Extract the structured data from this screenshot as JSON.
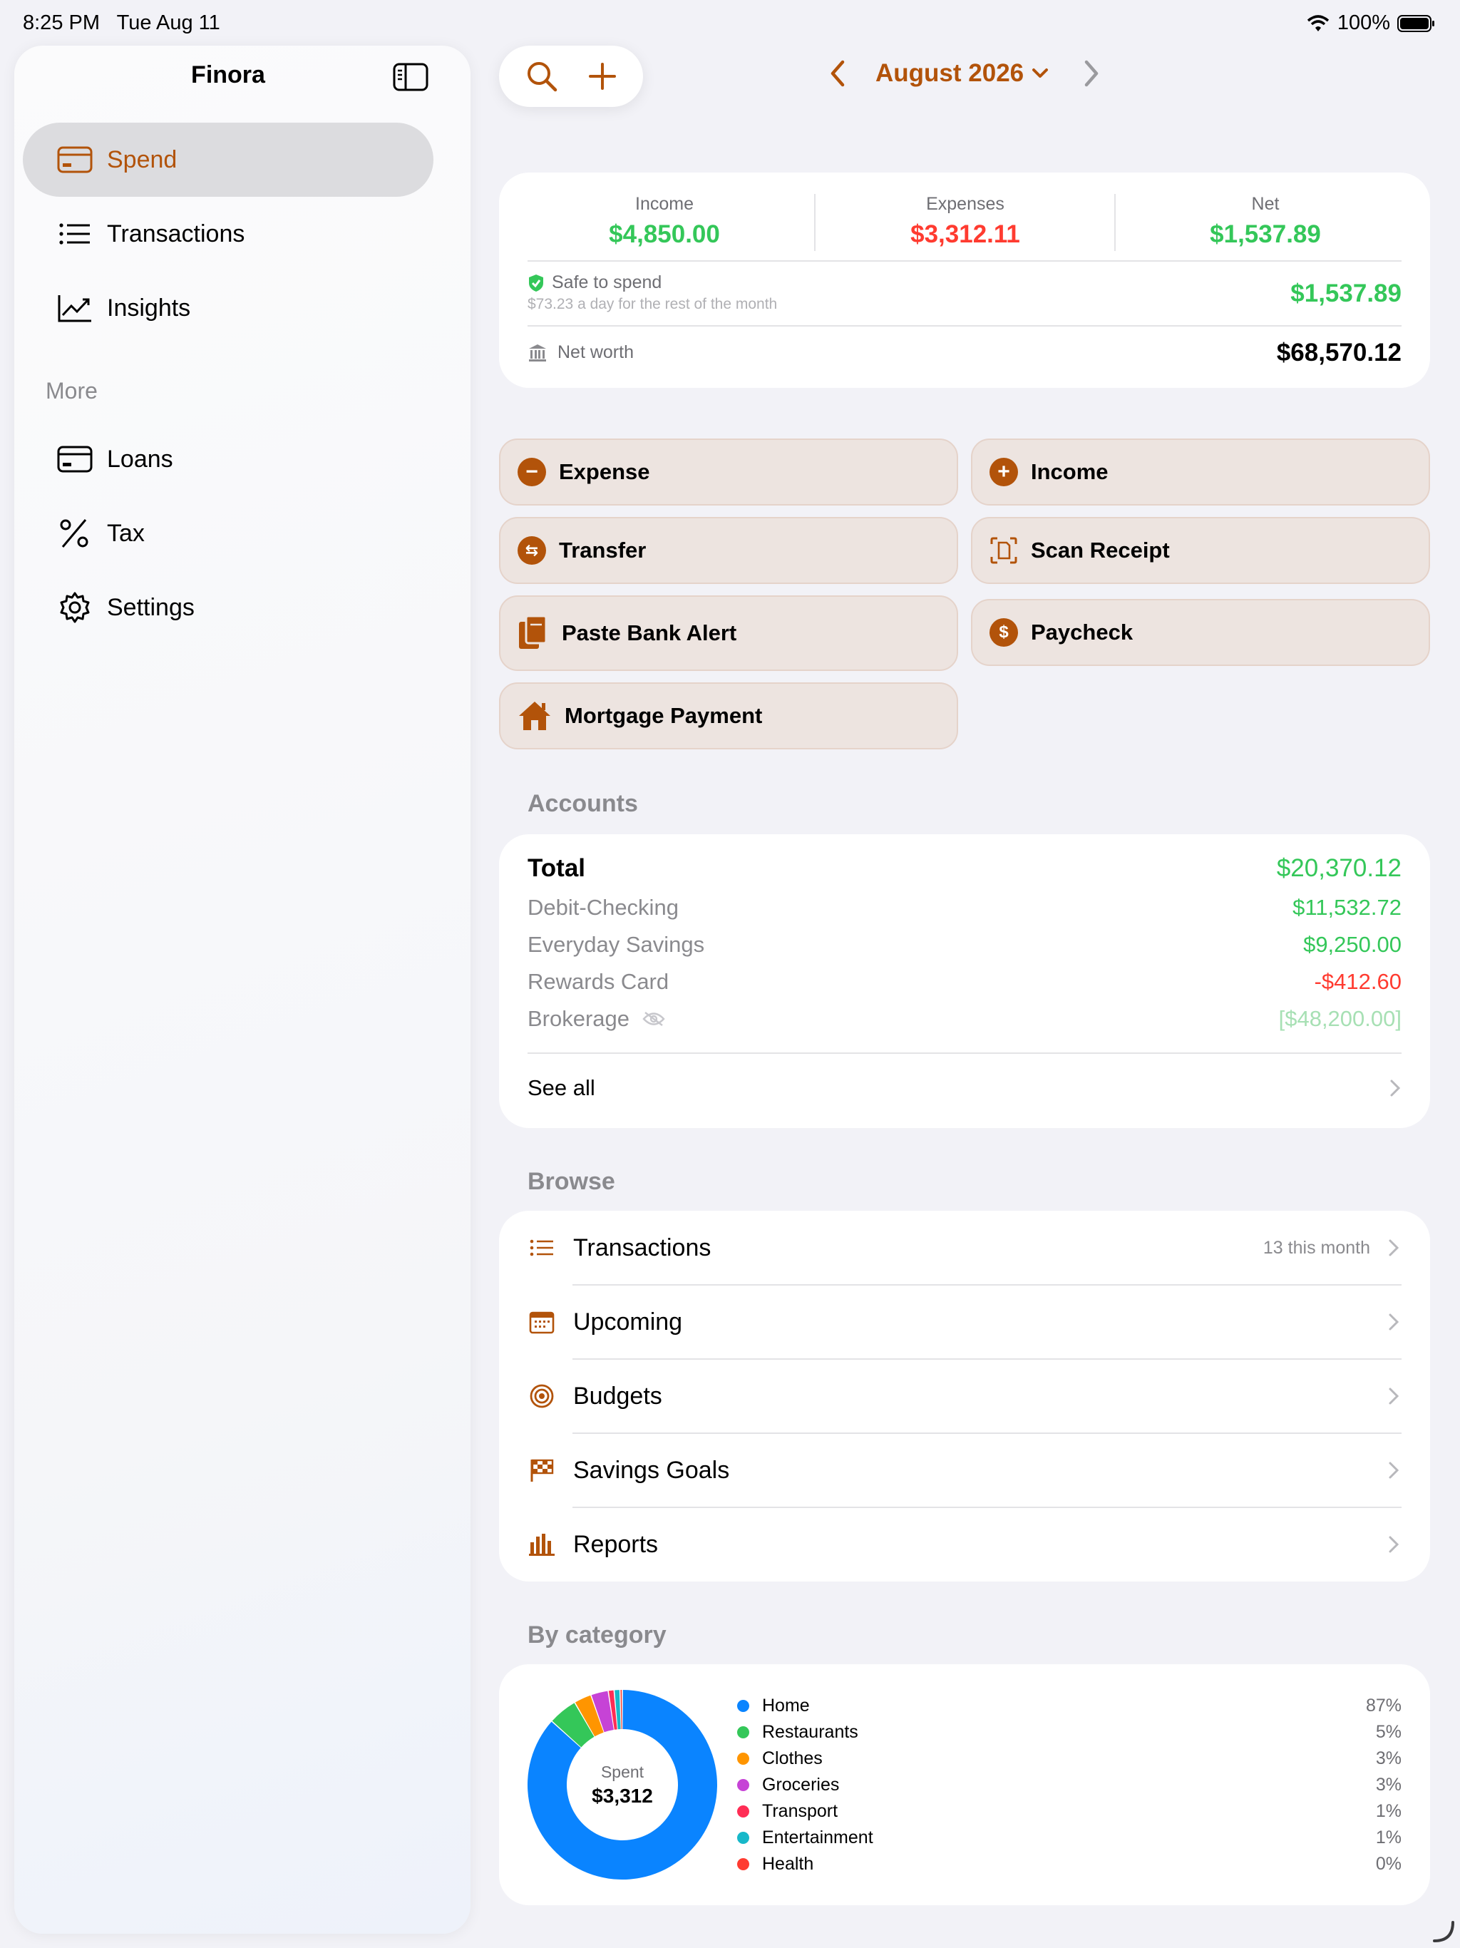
{
  "status": {
    "time": "8:25 PM",
    "date": "Tue Aug 11",
    "battery": "100%"
  },
  "sidebar": {
    "title": "Finora",
    "items": [
      {
        "label": "Spend"
      },
      {
        "label": "Transactions"
      },
      {
        "label": "Insights"
      }
    ],
    "more_label": "More",
    "more_items": [
      {
        "label": "Loans"
      },
      {
        "label": "Tax"
      },
      {
        "label": "Settings"
      }
    ]
  },
  "header": {
    "month": "August 2026"
  },
  "summary": {
    "income_label": "Income",
    "income": "$4,850.00",
    "expenses_label": "Expenses",
    "expenses": "$3,312.11",
    "net_label": "Net",
    "net": "$1,537.89",
    "safe_label": "Safe to spend",
    "safe_sub": "$73.23 a day for the rest of the month",
    "safe_value": "$1,537.89",
    "networth_label": "Net worth",
    "networth_value": "$68,570.12"
  },
  "actions": {
    "expense": "Expense",
    "income": "Income",
    "transfer": "Transfer",
    "scan": "Scan Receipt",
    "paste": "Paste Bank Alert",
    "paycheck": "Paycheck",
    "mortgage": "Mortgage Payment"
  },
  "accounts": {
    "title": "Accounts",
    "total_label": "Total",
    "total_value": "$20,370.12",
    "rows": [
      {
        "name": "Debit-Checking",
        "value": "$11,532.72"
      },
      {
        "name": "Everyday Savings",
        "value": "$9,250.00"
      },
      {
        "name": "Rewards Card",
        "value": "-$412.60"
      },
      {
        "name": "Brokerage",
        "value": "[$48,200.00]"
      }
    ],
    "see_all": "See all"
  },
  "browse": {
    "title": "Browse",
    "items": [
      {
        "label": "Transactions",
        "count": "13 this month"
      },
      {
        "label": "Upcoming"
      },
      {
        "label": "Budgets"
      },
      {
        "label": "Savings Goals"
      },
      {
        "label": "Reports"
      }
    ]
  },
  "category": {
    "title": "By category",
    "center_label": "Spent",
    "center_value": "$3,312",
    "items": [
      {
        "name": "Home",
        "pct": "87%",
        "value": 87,
        "color": "#0a84ff"
      },
      {
        "name": "Restaurants",
        "pct": "5%",
        "value": 5,
        "color": "#34c759"
      },
      {
        "name": "Clothes",
        "pct": "3%",
        "value": 3,
        "color": "#ff9500"
      },
      {
        "name": "Groceries",
        "pct": "3%",
        "value": 3,
        "color": "#c643d6"
      },
      {
        "name": "Transport",
        "pct": "1%",
        "value": 1,
        "color": "#ff2d55"
      },
      {
        "name": "Entertainment",
        "pct": "1%",
        "value": 1,
        "color": "#17b8c9"
      },
      {
        "name": "Health",
        "pct": "0%",
        "value": 0.4,
        "color": "#ff3b30"
      }
    ]
  },
  "colors": {
    "accent": "#b2530a",
    "positive": "#34c759",
    "negative": "#ff3b30"
  }
}
